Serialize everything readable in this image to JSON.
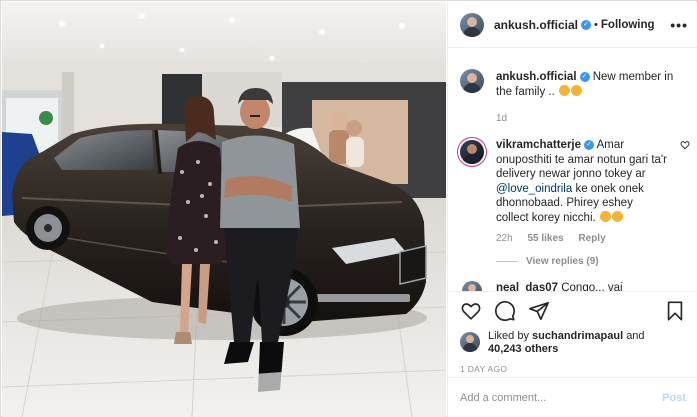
{
  "post": {
    "image": "Showroom photo of a man and a woman standing in front of a dark brown Skoda sedan",
    "brand_sign": "ŠKODA"
  },
  "header": {
    "username": "ankush.official",
    "separator": "•",
    "follow_status": "Following",
    "more_icon": "more-horizontal-icon"
  },
  "caption": {
    "username": "ankush.official",
    "text": "New member in the family ..",
    "time": "1d"
  },
  "comments": [
    {
      "username": "vikramchatterje",
      "text_before": "Amar onuposthiti te amar notun gari ta'r delivery newar jonno tokey ar",
      "mention": "@love_oindrila",
      "text_after": "ke onek onek dhonnobaad. Phirey eshey collect korey nicchi.",
      "time": "22h",
      "likes": "55 likes",
      "reply": "Reply",
      "view_replies": "View replies (9)"
    },
    {
      "username": "neal_das07",
      "text": "Congo... vai"
    }
  ],
  "actions": {
    "like_icon": "heart-icon",
    "comment_icon": "comment-icon",
    "share_icon": "share-icon",
    "save_icon": "bookmark-icon"
  },
  "likes": {
    "prefix": "Liked by",
    "user": "suchandrimapaul",
    "joiner": "and",
    "others": "40,243 others"
  },
  "timestamp": "1 DAY AGO",
  "add_comment": {
    "placeholder": "Add a comment...",
    "post_label": "Post"
  },
  "colors": {
    "link": "#00376b",
    "verified": "#3897f0",
    "muted": "#8e8e8e",
    "post_disabled": "#b3dbff"
  }
}
